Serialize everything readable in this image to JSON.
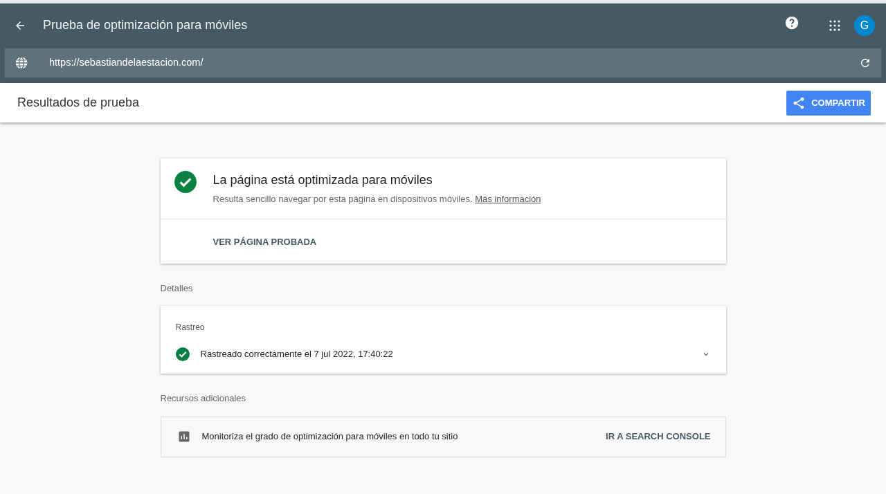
{
  "app_bar": {
    "title": "Prueba de optimización para móviles",
    "avatar": "G"
  },
  "url_bar": {
    "value": "https://sebastiandelaestacion.com/"
  },
  "results_bar": {
    "title": "Resultados de prueba",
    "share_button": "COMPARTIR"
  },
  "verdict": {
    "title": "La página está optimizada para móviles",
    "description": "Resulta sencillo navegar por esta página en dispositivos móviles.",
    "link": "Más información",
    "action": "VER PÁGINA PROBADA"
  },
  "details": {
    "heading": "Detalles",
    "card_title": "Rastreo",
    "status": "Rastreado correctamente el 7 jul 2022, 17:40:22",
    "expanded": false
  },
  "resources": {
    "heading": "Recursos adicionales",
    "text": "Monitoriza el grado de optimización para móviles en todo tu sitio",
    "action": "IR A SEARCH CONSOLE"
  }
}
